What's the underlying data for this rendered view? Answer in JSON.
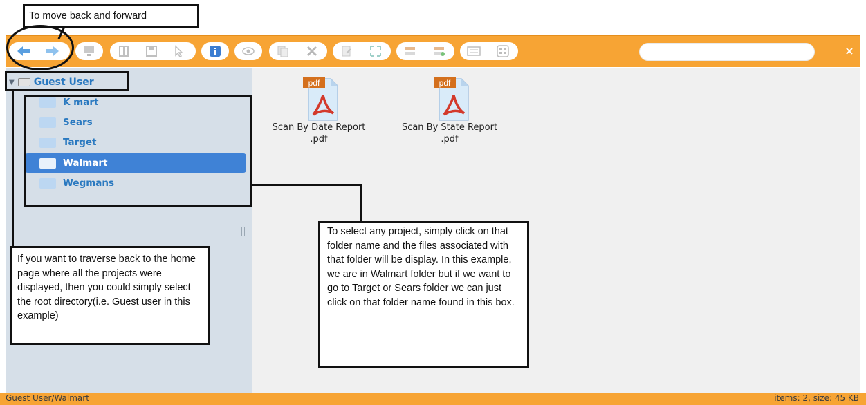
{
  "annotations": {
    "nav_note": "To move back and forward",
    "root_note": "If you want to traverse back to the home page where all the projects were displayed, then you could simply select the root directory(i.e. Guest user in this example)",
    "folder_note": "To select any project, simply click on that folder name and the files associated with that folder will be display. In this example, we are in Walmart folder but if we want to go to Target or Sears folder we can just click on that folder name found in this box."
  },
  "search": {
    "value": "",
    "placeholder": ""
  },
  "close_label": "×",
  "tree": {
    "root": "Guest User",
    "folders": [
      {
        "label": "K mart",
        "selected": false
      },
      {
        "label": "Sears",
        "selected": false
      },
      {
        "label": "Target",
        "selected": false
      },
      {
        "label": "Walmart",
        "selected": true
      },
      {
        "label": "Wegmans",
        "selected": false
      }
    ]
  },
  "files": [
    {
      "badge": "pdf",
      "name_line1": "Scan By Date Report",
      "name_line2": ".pdf"
    },
    {
      "badge": "pdf",
      "name_line1": "Scan By State Report",
      "name_line2": ".pdf"
    }
  ],
  "status": {
    "path": "Guest User/Walmart",
    "summary": "items: 2, size: 45 KB"
  },
  "colors": {
    "toolbar": "#f7a434",
    "sidebar": "#d6dfe8",
    "selected": "#3f82d6",
    "link": "#2a79c0"
  },
  "toolbar_icons": [
    "back-arrow-icon",
    "forward-arrow-icon",
    "computer-icon",
    "book-icon",
    "save-icon",
    "cursor-icon",
    "info-icon",
    "eye-icon",
    "copy-icon",
    "cut-icon",
    "edit-icon",
    "expand-icon",
    "tree-view-icon",
    "tree-add-icon",
    "list-view-icon",
    "grid-view-icon"
  ]
}
